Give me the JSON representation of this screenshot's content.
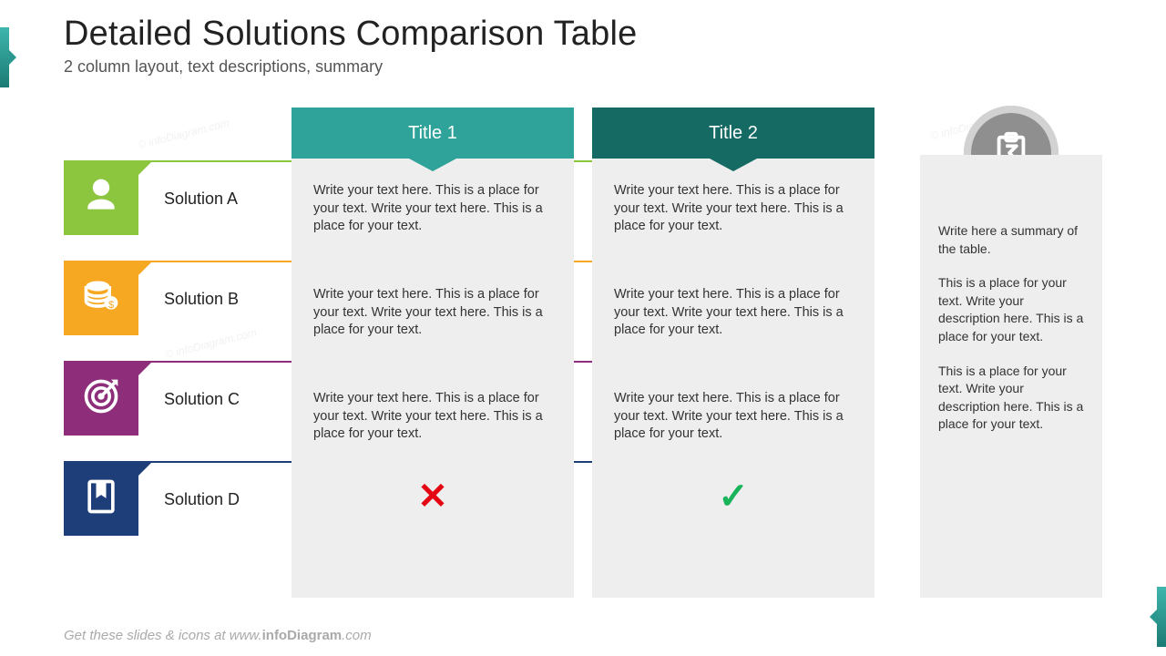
{
  "title": "Detailed Solutions Comparison Table",
  "subtitle": "2 column layout, text descriptions, summary",
  "watermark": "© infoDiagram.com",
  "rows": [
    {
      "label": "Solution A",
      "color": "#8cc63f",
      "icon": "person-icon"
    },
    {
      "label": "Solution B",
      "color": "#f7a823",
      "icon": "coins-icon"
    },
    {
      "label": "Solution C",
      "color": "#8e2e7a",
      "icon": "target-icon"
    },
    {
      "label": "Solution D",
      "color": "#1d3e79",
      "icon": "bookmark-icon"
    }
  ],
  "columns": [
    {
      "title": "Title 1",
      "header_color": "#2fa39a",
      "cells": [
        "Write your text here. This is a place for your text. Write your text here. This is a place for your text.",
        "Write your text here. This is a place for your text. Write your text here. This is a place for your text.",
        "Write your text here. This is a place for your text. Write your text here. This is a place for your text."
      ],
      "mark": "✕",
      "mark_color": "#e40613"
    },
    {
      "title": "Title 2",
      "header_color": "#156a64",
      "cells": [
        "Write your text here. This is a place for your text. Write your text here. This is a place for your text.",
        "Write your text here. This is a place for your text. Write your text here. This is a place for your text.",
        "Write your text here. This is a place for your text. Write your text here. This is a place for your text."
      ],
      "mark": "✓",
      "mark_color": "#19b35a"
    }
  ],
  "summary": {
    "p1": "Write here a summary of the table.",
    "p2": "This is a place for your text. Write your description here. This is a place for your text.",
    "p3": "This is a place for your text. Write your description here. This is a place for your text."
  },
  "footer_prefix": "Get these slides & icons at www.",
  "footer_brand": "infoDiagram",
  "footer_suffix": ".com"
}
